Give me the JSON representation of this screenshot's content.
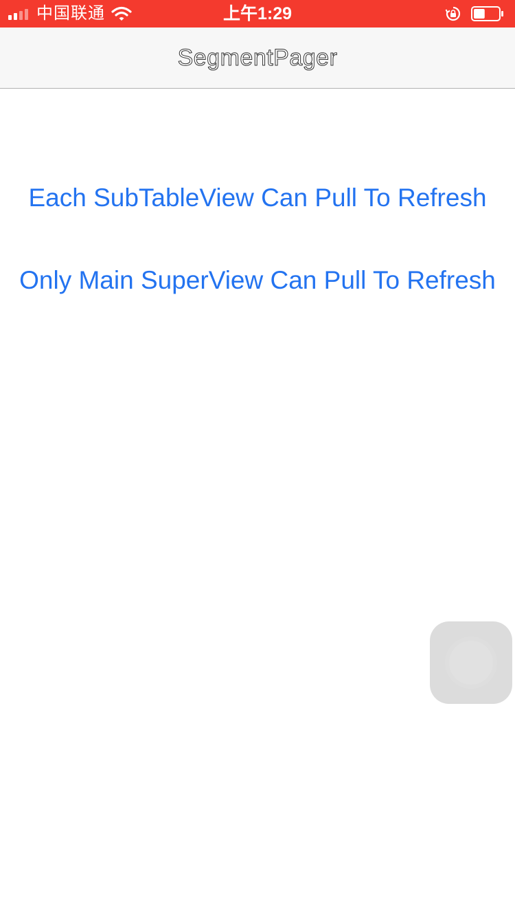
{
  "status_bar": {
    "carrier": "中国联通",
    "time": "上午1:29",
    "signal_bars_filled": 2,
    "signal_bars_total": 4,
    "battery_level": 0.45,
    "background_color": "#f43a2e",
    "icons": [
      "signal-icon",
      "wifi-icon",
      "rotation-lock-icon",
      "battery-icon"
    ]
  },
  "nav_bar": {
    "title": "SegmentPager"
  },
  "main": {
    "buttons": [
      {
        "label": "Each SubTableView Can Pull To Refresh"
      },
      {
        "label": "Only Main SuperView Can Pull To Refresh"
      }
    ],
    "link_color": "#2373f0"
  },
  "assistive_touch": {
    "icon": "assistive-touch-icon"
  }
}
